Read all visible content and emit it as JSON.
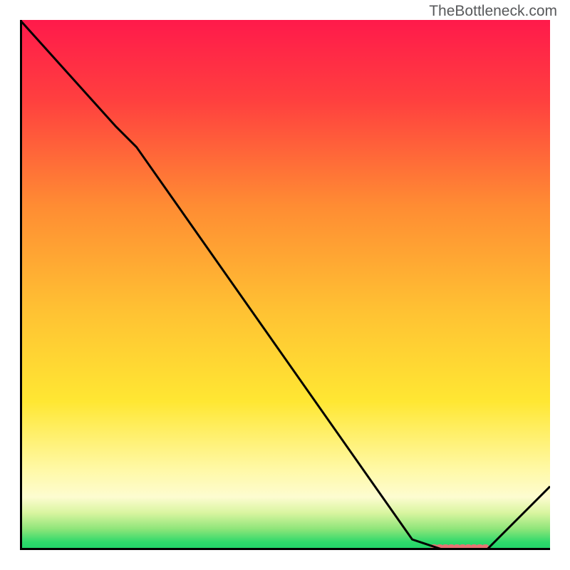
{
  "watermark": "TheBottleneck.com",
  "chart_data": {
    "type": "line",
    "title": "",
    "xlabel": "",
    "ylabel": "",
    "xlim": [
      0,
      100
    ],
    "ylim": [
      0,
      100
    ],
    "series": [
      {
        "name": "curve",
        "x": [
          0,
          18,
          22,
          74,
          80,
          88,
          100
        ],
        "values": [
          100,
          80,
          76,
          2,
          0,
          0,
          12
        ]
      }
    ],
    "annotations": [
      {
        "type": "segment",
        "name": "minimum-marker",
        "x0": 78,
        "x1": 88,
        "y": 0,
        "color": "#e57373"
      }
    ],
    "gradient_stops": [
      {
        "offset": 0.0,
        "color": "#ff1a4b"
      },
      {
        "offset": 0.15,
        "color": "#ff3f3f"
      },
      {
        "offset": 0.35,
        "color": "#ff8c33"
      },
      {
        "offset": 0.55,
        "color": "#ffc233"
      },
      {
        "offset": 0.72,
        "color": "#ffe733"
      },
      {
        "offset": 0.85,
        "color": "#fff9a8"
      },
      {
        "offset": 0.9,
        "color": "#fdfcd0"
      },
      {
        "offset": 0.93,
        "color": "#d9f5a0"
      },
      {
        "offset": 0.96,
        "color": "#8fe57a"
      },
      {
        "offset": 0.985,
        "color": "#2fd96b"
      },
      {
        "offset": 1.0,
        "color": "#1fd168"
      }
    ],
    "axis_color": "#000000",
    "line_color": "#000000",
    "line_width": 3
  }
}
